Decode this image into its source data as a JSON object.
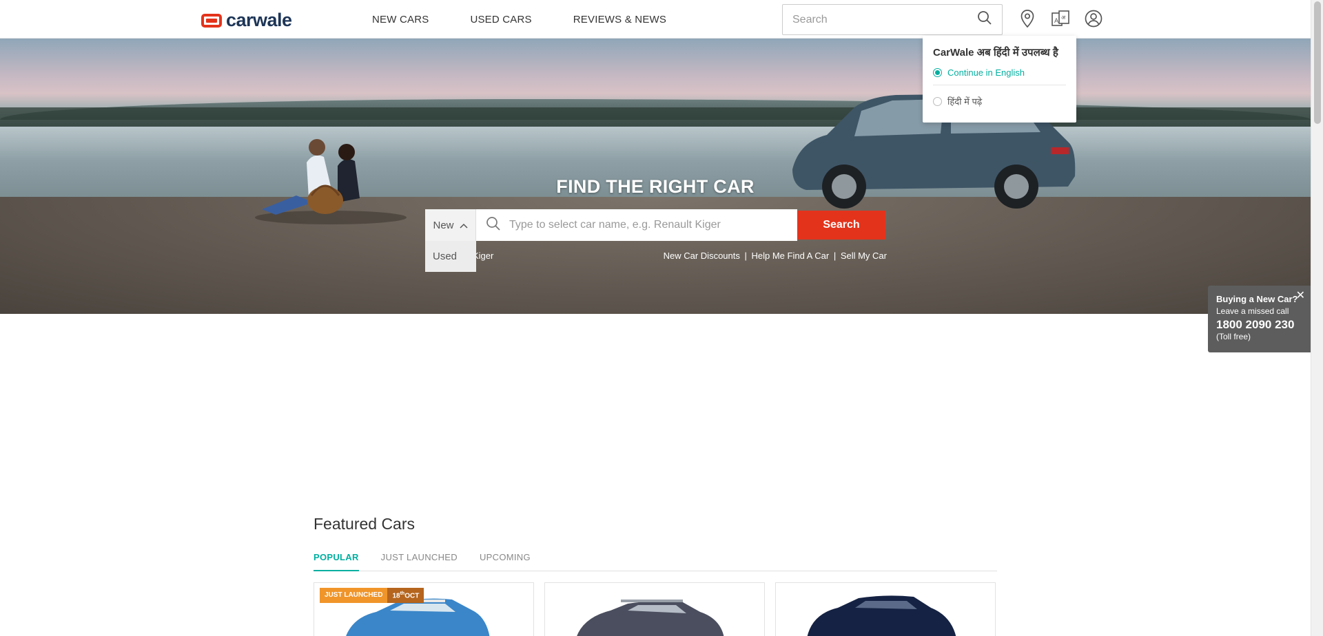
{
  "header": {
    "logo_text": "carwale",
    "nav": [
      "NEW CARS",
      "USED CARS",
      "REVIEWS & NEWS"
    ],
    "search_placeholder": "Search",
    "icons": [
      "location-icon",
      "language-icon",
      "user-account-icon"
    ]
  },
  "language_popup": {
    "title": "CarWale अब हिंदी में उपलब्ध है",
    "options": [
      {
        "label": "Continue in English",
        "selected": true
      },
      {
        "label": "हिंदी में पढ़े",
        "selected": false
      }
    ]
  },
  "hero": {
    "title": "FIND THE RIGHT CAR",
    "type_selected": "New",
    "type_dropdown_option": "Used",
    "search_placeholder": "Type to select car name, e.g. Renault Kiger",
    "search_button": "Search",
    "quick_left": "Kiger",
    "quick_links": [
      "New Car Discounts",
      "Help Me Find A Car",
      "Sell My Car"
    ]
  },
  "missed_call": {
    "title": "Buying a New Car?",
    "subtitle": "Leave a missed call",
    "number": "1800 2090 230",
    "note": "(Toll free)"
  },
  "featured": {
    "title": "Featured Cars",
    "tabs": [
      "POPULAR",
      "JUST LAUNCHED",
      "UPCOMING"
    ],
    "active_tab": "POPULAR",
    "first_card_badge": "JUST LAUNCHED",
    "first_card_date_day": "18",
    "first_card_date_suffix": "th",
    "first_card_date_month": "OCT"
  },
  "colors": {
    "brand_red": "#e4331b",
    "accent_teal": "#00afa0",
    "badge_orange": "#f0952a"
  }
}
